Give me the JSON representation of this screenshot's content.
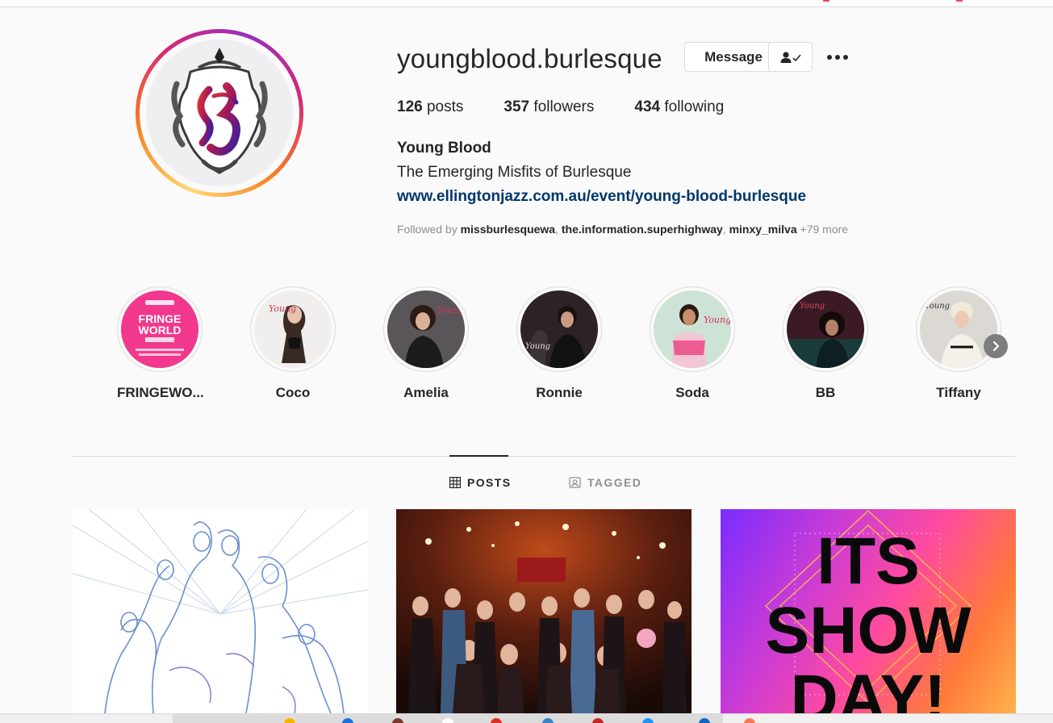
{
  "profile": {
    "username": "youngblood.burlesque",
    "message_label": "Message",
    "posts_count": "126",
    "posts_label": "posts",
    "followers_count": "357",
    "followers_label": "followers",
    "following_count": "434",
    "following_label": "following",
    "full_name": "Young Blood",
    "bio": "The Emerging Misfits of Burlesque",
    "link": "www.ellingtonjazz.com.au/event/young-blood-burlesque",
    "followed_by_prefix": "Followed by",
    "followed_by_names": [
      "missburlesquewa",
      "the.information.superhighway",
      "minxy_milva"
    ],
    "followed_by_more": "+79 more"
  },
  "highlights": [
    {
      "label": "FRINGEWO...",
      "color": "#f2388c"
    },
    {
      "label": "Coco",
      "color": "#e9e6e4"
    },
    {
      "label": "Amelia",
      "color": "#5a5558"
    },
    {
      "label": "Ronnie",
      "color": "#2b2326"
    },
    {
      "label": "Soda",
      "color": "#e8c9d1"
    },
    {
      "label": "BB",
      "color": "#3b1a25"
    },
    {
      "label": "Tiffany",
      "color": "#d9d6d2"
    }
  ],
  "fringe_badge": {
    "line1": "FRINGE",
    "line2": "WORLD"
  },
  "tabs": {
    "posts": "POSTS",
    "tagged": "TAGGED"
  },
  "posts": [
    {
      "type": "illustration"
    },
    {
      "type": "photo"
    },
    {
      "type": "graphic",
      "line1": "ITS",
      "line2": "SHOW",
      "line3": "DAY!"
    }
  ],
  "icons": {
    "more": "more-dots-icon",
    "following": "person-check-icon",
    "next": "chevron-right-icon",
    "grid": "grid-icon",
    "tagged": "tagged-icon"
  },
  "colors": {
    "link": "#00376b",
    "text": "#262626",
    "muted": "#8e8e8e",
    "border": "#dbdbdb"
  }
}
